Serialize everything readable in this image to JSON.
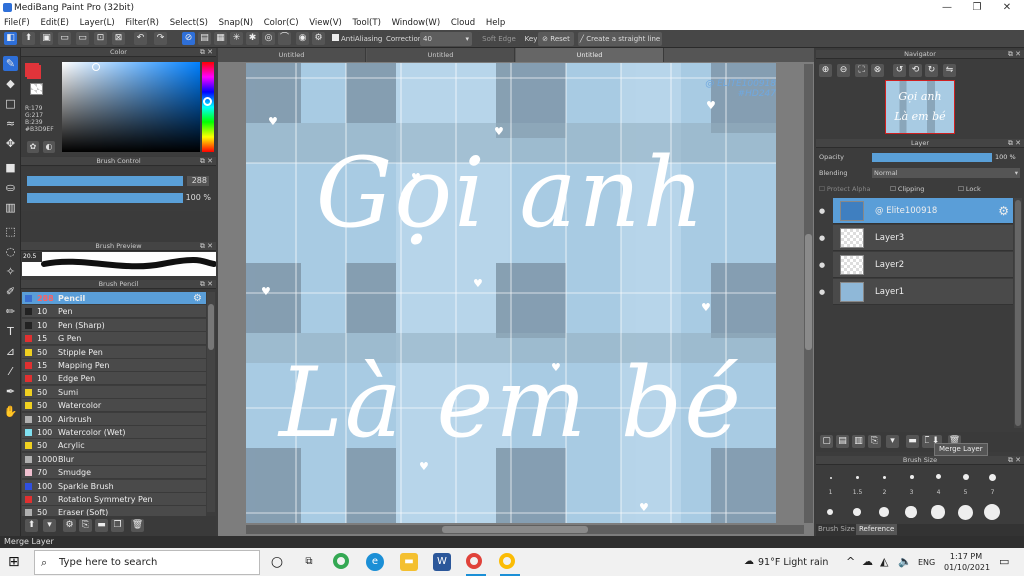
{
  "window": {
    "title": "MediBang Paint Pro (32bit)"
  },
  "menu": [
    "File(F)",
    "Edit(E)",
    "Layer(L)",
    "Filter(R)",
    "Select(S)",
    "Snap(N)",
    "Color(C)",
    "View(V)",
    "Tool(T)",
    "Window(W)",
    "Cloud",
    "Help"
  ],
  "toolbar": {
    "antialiasing": "AntiAliasing",
    "correction_label": "Correction",
    "correction_value": "40",
    "soft_edge": "Soft Edge",
    "key": "Key",
    "reset": "Reset",
    "straight_line": "Create a straight line"
  },
  "color_panel": {
    "title": "Color",
    "r": "R:179",
    "g": "G:217",
    "b": "B:239",
    "hex": "#B3D9EF",
    "fg": "#e0343a",
    "bg": "#ffffff"
  },
  "brush_control": {
    "title": "Brush Control",
    "size": "288",
    "opacity": "100 %"
  },
  "brush_preview": {
    "title": "Brush Preview",
    "size": "20.5"
  },
  "brush_list": {
    "title": "Brush Pencil",
    "items": [
      {
        "size": "288",
        "name": "Pencil",
        "color": "#3a6fd0"
      },
      {
        "size": "10",
        "name": "Pen",
        "color": "#222222"
      },
      {
        "size": "10",
        "name": "Pen (Sharp)",
        "color": "#222222"
      },
      {
        "size": "15",
        "name": "G Pen",
        "color": "#e03030"
      },
      {
        "size": "50",
        "name": "Stipple Pen",
        "color": "#f0d020"
      },
      {
        "size": "15",
        "name": "Mapping Pen",
        "color": "#e03030"
      },
      {
        "size": "10",
        "name": "Edge Pen",
        "color": "#e03030"
      },
      {
        "size": "50",
        "name": "Sumi",
        "color": "#f0d020"
      },
      {
        "size": "50",
        "name": "Watercolor",
        "color": "#f0d020"
      },
      {
        "size": "100",
        "name": "Airbrush",
        "color": "#b0b0b0"
      },
      {
        "size": "100",
        "name": "Watercolor (Wet)",
        "color": "#80e0f0"
      },
      {
        "size": "50",
        "name": "Acrylic",
        "color": "#f0d020"
      },
      {
        "size": "1000",
        "name": "Blur",
        "color": "#b0b0b0"
      },
      {
        "size": "70",
        "name": "Smudge",
        "color": "#f0c0d0"
      },
      {
        "size": "100",
        "name": "Sparkle Brush",
        "color": "#3050e0"
      },
      {
        "size": "10",
        "name": "Rotation Symmetry Pen",
        "color": "#e03030"
      },
      {
        "size": "50",
        "name": "Eraser (Soft)",
        "color": "#b0b0b0"
      }
    ]
  },
  "canvas": {
    "tabs": [
      "Untitled",
      "Untitled",
      "Untitled"
    ],
    "watermark_line1": "@ ELITE100918",
    "watermark_line2": "#HD247",
    "text_line1": "Gọi anh",
    "text_line2": "Là em bé"
  },
  "navigator": {
    "title": "Navigator",
    "thumb_line1": "Gọi anh",
    "thumb_line2": "Là em bé"
  },
  "layer_panel": {
    "title": "Layer",
    "opacity_label": "Opacity",
    "opacity_value": "100 %",
    "blending_label": "Blending",
    "blending_value": "Normal",
    "protect_alpha": "Protect Alpha",
    "clipping": "Clipping",
    "lock": "Lock",
    "layers": [
      {
        "name": "@ Elite100918",
        "selected": true
      },
      {
        "name": "Layer3",
        "selected": false
      },
      {
        "name": "Layer2",
        "selected": false
      },
      {
        "name": "Layer1",
        "selected": false
      }
    ],
    "tooltip": "Merge Layer"
  },
  "brush_size": {
    "title": "Brush Size",
    "labels": [
      "1",
      "1.5",
      "2",
      "3",
      "4",
      "5",
      "7"
    ],
    "tab_brush_size": "Brush Size",
    "tab_reference": "Reference"
  },
  "status": {
    "text": "Merge Layer"
  },
  "taskbar": {
    "search_placeholder": "Type here to search",
    "weather": "91°F  Light rain",
    "lang": "ENG",
    "time": "1:17 PM",
    "date": "01/10/2021"
  }
}
